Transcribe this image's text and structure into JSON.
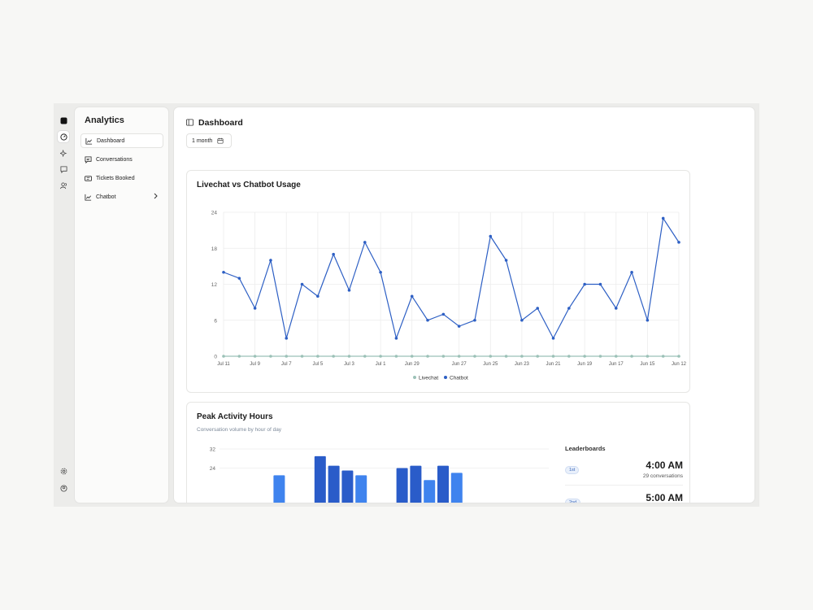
{
  "sidebar": {
    "title": "Analytics",
    "items": [
      {
        "label": "Dashboard",
        "icon": "line-chart-icon",
        "active": true
      },
      {
        "label": "Conversations",
        "icon": "chat-icon",
        "active": false
      },
      {
        "label": "Tickets Booked",
        "icon": "ticket-icon",
        "active": false
      },
      {
        "label": "Chatbot",
        "icon": "line-chart-icon",
        "active": false,
        "has_submenu": true
      }
    ]
  },
  "rail": {
    "icons": [
      "app-logo-icon",
      "analytics-icon",
      "sparkles-icon",
      "message-icon",
      "users-icon",
      "settings-icon",
      "account-icon"
    ]
  },
  "header": {
    "title": "Dashboard"
  },
  "date_range": {
    "label": "1 month"
  },
  "usage_card": {
    "title": "Livechat vs Chatbot Usage"
  },
  "activity_card": {
    "title": "Peak Activity Hours",
    "subtitle": "Conversation volume by hour of day"
  },
  "leaderboard": {
    "title": "Leaderboards",
    "entries": [
      {
        "rank": "1st",
        "time": "4:00 AM",
        "count": "29 conversations"
      },
      {
        "rank": "2nd",
        "time": "5:00 AM",
        "count": ""
      }
    ]
  },
  "colors": {
    "chatbot": "#2d5fc4",
    "livechat": "#9bc1b7",
    "bar_dark": "#2a5cc9",
    "bar_light": "#3f83ee"
  },
  "chart_data": [
    {
      "type": "line",
      "title": "Livechat vs Chatbot Usage",
      "x_tick_labels": [
        "Jul 11",
        "Jul 9",
        "Jul 7",
        "Jul 5",
        "Jul 3",
        "Jul 1",
        "Jun 29",
        "Jun 27",
        "Jun 25",
        "Jun 23",
        "Jun 21",
        "Jun 19",
        "Jun 17",
        "Jun 15",
        "Jun 12"
      ],
      "ylim": [
        0,
        24
      ],
      "y_ticks": [
        0,
        6,
        12,
        18,
        24
      ],
      "grid": true,
      "legend": "bottom-center",
      "series": [
        {
          "name": "Livechat",
          "values": [
            0,
            0,
            0,
            0,
            0,
            0,
            0,
            0,
            0,
            0,
            0,
            0,
            0,
            0,
            0,
            0,
            0,
            0,
            0,
            0,
            0,
            0,
            0,
            0,
            0,
            0,
            0,
            0,
            0,
            0
          ]
        },
        {
          "name": "Chatbot",
          "values": [
            14,
            13,
            8,
            16,
            3,
            12,
            10,
            17,
            11,
            19,
            14,
            3,
            10,
            6,
            7,
            5,
            6,
            20,
            16,
            6,
            8,
            3,
            8,
            12,
            12,
            8,
            14,
            6,
            23,
            19
          ]
        }
      ]
    },
    {
      "type": "bar",
      "title": "Peak Activity Hours",
      "y_ticks": [
        24,
        32
      ],
      "ylim": [
        0,
        32
      ],
      "grid": true,
      "values": [
        null,
        null,
        null,
        21,
        null,
        null,
        29,
        25,
        23,
        21,
        null,
        null,
        24,
        25,
        19,
        25,
        22
      ]
    }
  ]
}
